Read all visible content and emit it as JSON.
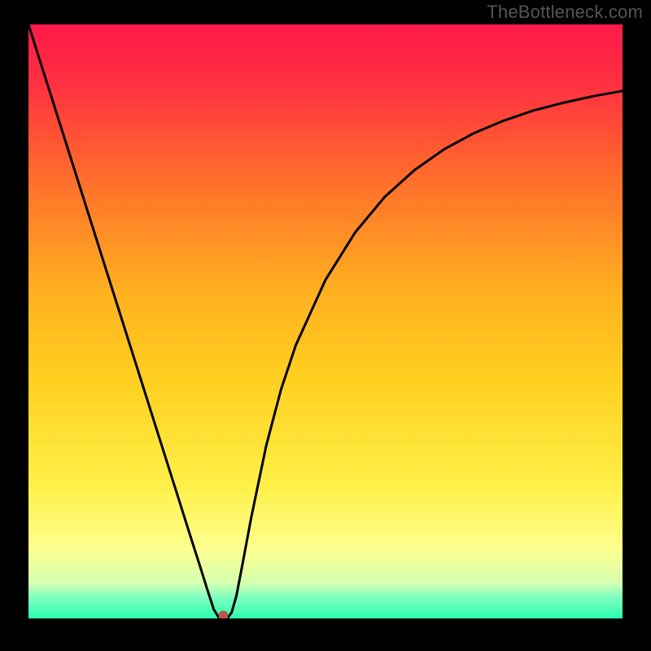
{
  "watermark": "TheBottleneck.com",
  "chart_data": {
    "type": "line",
    "title": "",
    "xlabel": "",
    "ylabel": "",
    "xlim": [
      0,
      1
    ],
    "ylim": [
      0,
      1
    ],
    "background_gradient": {
      "stops": [
        {
          "offset": 0.0,
          "color": "#ff1a49"
        },
        {
          "offset": 0.1,
          "color": "#ff3040"
        },
        {
          "offset": 0.25,
          "color": "#ff6a2c"
        },
        {
          "offset": 0.45,
          "color": "#ffb020"
        },
        {
          "offset": 0.6,
          "color": "#ffd020"
        },
        {
          "offset": 0.78,
          "color": "#fff04a"
        },
        {
          "offset": 0.88,
          "color": "#fdff8c"
        },
        {
          "offset": 0.94,
          "color": "#d6ffb0"
        },
        {
          "offset": 0.965,
          "color": "#7dffc0"
        },
        {
          "offset": 1.0,
          "color": "#2affaf"
        }
      ]
    },
    "series": [
      {
        "name": "bottleneck-curve",
        "color": "#000000",
        "x": [
          0.0,
          0.025,
          0.05,
          0.075,
          0.1,
          0.125,
          0.15,
          0.175,
          0.2,
          0.225,
          0.25,
          0.275,
          0.29,
          0.3,
          0.312,
          0.32,
          0.325,
          0.33,
          0.336,
          0.342,
          0.35,
          0.36,
          0.375,
          0.4,
          0.425,
          0.45,
          0.5,
          0.55,
          0.6,
          0.65,
          0.7,
          0.75,
          0.8,
          0.85,
          0.9,
          0.95,
          1.0
        ],
        "values": [
          1.0,
          0.921,
          0.842,
          0.763,
          0.684,
          0.605,
          0.526,
          0.447,
          0.368,
          0.289,
          0.21,
          0.131,
          0.084,
          0.052,
          0.015,
          0.002,
          0.001,
          0.001,
          0.002,
          0.01,
          0.038,
          0.09,
          0.17,
          0.29,
          0.385,
          0.46,
          0.57,
          0.65,
          0.71,
          0.755,
          0.79,
          0.817,
          0.838,
          0.855,
          0.868,
          0.879,
          0.888
        ]
      }
    ],
    "markers": [
      {
        "name": "minimum-dot",
        "x": 0.328,
        "y": 0.005,
        "color": "#b9564e",
        "radius": 6
      }
    ]
  }
}
